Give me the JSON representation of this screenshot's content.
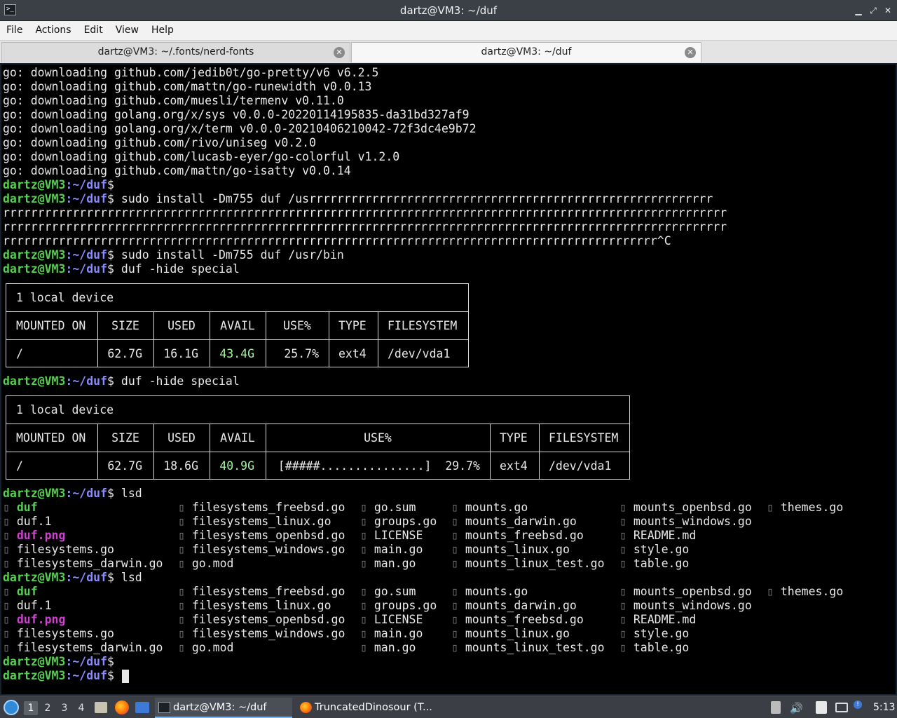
{
  "window": {
    "title": "dartz@VM3: ~/duf",
    "buttons": {
      "minimize": "▁",
      "maximize": "⤢",
      "close": "✕"
    }
  },
  "menu": [
    "File",
    "Actions",
    "Edit",
    "View",
    "Help"
  ],
  "tabs": [
    {
      "label": "dartz@VM3: ~/.fonts/nerd-fonts",
      "active": false
    },
    {
      "label": "dartz@VM3: ~/duf",
      "active": true
    }
  ],
  "terminal": {
    "prompt_user": "dartz@VM3",
    "prompt_path": ":~/duf",
    "prompt_sigil": "$",
    "download_lines": [
      "go: downloading github.com/jedib0t/go-pretty/v6 v6.2.5",
      "go: downloading github.com/mattn/go-runewidth v0.0.13",
      "go: downloading github.com/muesli/termenv v0.11.0",
      "go: downloading golang.org/x/sys v0.0.0-20220114195835-da31bd327af9",
      "go: downloading golang.org/x/term v0.0.0-20210406210042-72f3dc4e9b72",
      "go: downloading github.com/rivo/uniseg v0.2.0",
      "go: downloading github.com/lucasb-eyer/go-colorful v1.2.0",
      "go: downloading github.com/mattn/go-isatty v0.0.14"
    ],
    "cmd_install_typo": " sudo install -Dm755 duf /usrrrrrrrrrrrrrrrrrrrrrrrrrrrrrrrrrrrrrrrrrrrrrrrrrrrrrrrrrr",
    "typo_wrap_1": "rrrrrrrrrrrrrrrrrrrrrrrrrrrrrrrrrrrrrrrrrrrrrrrrrrrrrrrrrrrrrrrrrrrrrrrrrrrrrrrrrrrrrrrrrrrrrrrrrrrrrrrr",
    "typo_wrap_2": "rrrrrrrrrrrrrrrrrrrrrrrrrrrrrrrrrrrrrrrrrrrrrrrrrrrrrrrrrrrrrrrrrrrrrrrrrrrrrrrrrrrrrrrrrrrrrrrrrrrrrrrr",
    "typo_wrap_3": "rrrrrrrrrrrrrrrrrrrrrrrrrrrrrrrrrrrrrrrrrrrrrrrrrrrrrrrrrrrrrrrrrrrrrrrrrrrrrrrrrrrrrrrrrrrrrr^C",
    "cmd_install": " sudo install -Dm755 duf /usr/bin",
    "cmd_duf": " duf -hide special",
    "cmd_lsd": " lsd",
    "duf1": {
      "caption": "1 local device",
      "headers": [
        "MOUNTED ON",
        "SIZE",
        "USED",
        "AVAIL",
        "USE%",
        "TYPE",
        "FILESYSTEM"
      ],
      "row": [
        "/",
        "62.7G",
        "16.1G",
        "43.4G",
        "25.7%",
        "ext4",
        "/dev/vda1"
      ]
    },
    "duf2": {
      "caption": "1 local device",
      "headers": [
        "MOUNTED ON",
        "SIZE",
        "USED",
        "AVAIL",
        "USE%",
        "TYPE",
        "FILESYSTEM"
      ],
      "row": [
        "/",
        "62.7G",
        "18.6G",
        "40.9G",
        "[#####...............]  29.7%",
        "ext4",
        "/dev/vda1"
      ]
    },
    "lsd_columns": [
      [
        {
          "name": "duf",
          "kind": "exe"
        },
        {
          "name": "duf.1",
          "kind": "file"
        },
        {
          "name": "duf.png",
          "kind": "img"
        },
        {
          "name": "filesystems.go",
          "kind": "file"
        },
        {
          "name": "filesystems_darwin.go",
          "kind": "file"
        }
      ],
      [
        {
          "name": "filesystems_freebsd.go",
          "kind": "file"
        },
        {
          "name": "filesystems_linux.go",
          "kind": "file"
        },
        {
          "name": "filesystems_openbsd.go",
          "kind": "file"
        },
        {
          "name": "filesystems_windows.go",
          "kind": "file"
        },
        {
          "name": "go.mod",
          "kind": "file"
        }
      ],
      [
        {
          "name": "go.sum",
          "kind": "file"
        },
        {
          "name": "groups.go",
          "kind": "file"
        },
        {
          "name": "LICENSE",
          "kind": "file"
        },
        {
          "name": "main.go",
          "kind": "file"
        },
        {
          "name": "man.go",
          "kind": "file"
        }
      ],
      [
        {
          "name": "mounts.go",
          "kind": "file"
        },
        {
          "name": "mounts_darwin.go",
          "kind": "file"
        },
        {
          "name": "mounts_freebsd.go",
          "kind": "file"
        },
        {
          "name": "mounts_linux.go",
          "kind": "file"
        },
        {
          "name": "mounts_linux_test.go",
          "kind": "file"
        }
      ],
      [
        {
          "name": "mounts_openbsd.go",
          "kind": "file"
        },
        {
          "name": "mounts_windows.go",
          "kind": "file"
        },
        {
          "name": "README.md",
          "kind": "file"
        },
        {
          "name": "style.go",
          "kind": "file"
        },
        {
          "name": "table.go",
          "kind": "file"
        }
      ],
      [
        {
          "name": "themes.go",
          "kind": "file"
        }
      ]
    ],
    "glyph": "▯"
  },
  "taskbar": {
    "workspaces": [
      "1",
      "2",
      "3",
      "4"
    ],
    "tasks": [
      {
        "label": "dartz@VM3: ~/duf",
        "icon": "terminal-icon",
        "active": true
      },
      {
        "label": "TruncatedDinosour (T...",
        "icon": "firefox-icon",
        "active": false
      }
    ],
    "clock": "5:13"
  }
}
